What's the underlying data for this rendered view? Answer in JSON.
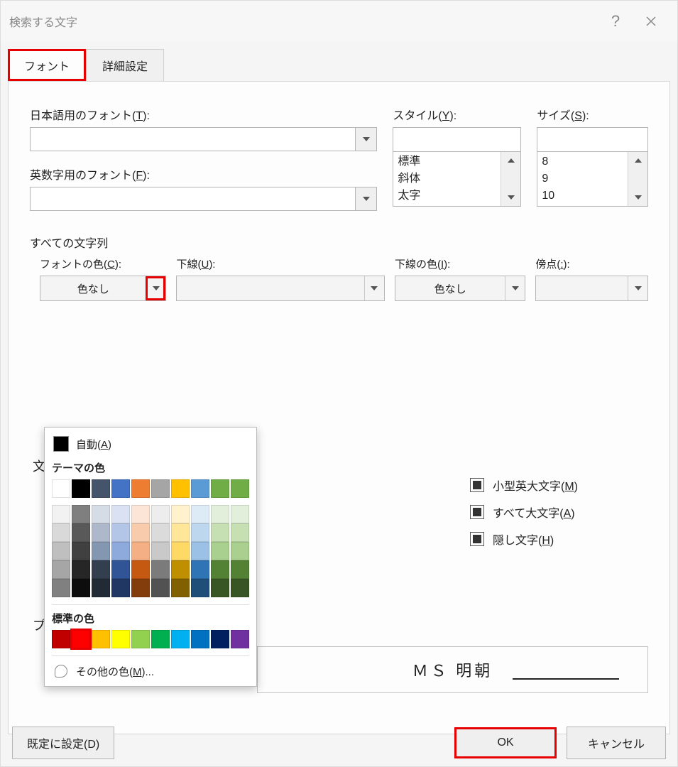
{
  "title": "検索する文字",
  "tabs": {
    "font": "フォント",
    "adv": "詳細設定"
  },
  "labels": {
    "jpfont": "日本語用のフォント(",
    "jpfont_key": "T",
    "enfont": "英数字用のフォント(",
    "enfont_key": "F",
    "style": "スタイル(",
    "style_key": "Y",
    "size": "サイズ(",
    "size_key": "S",
    "allchars": "すべての文字列",
    "fontcolor": "フォントの色(",
    "fontcolor_key": "C",
    "underline": "下線(",
    "underline_key": "U",
    "ulcolor": "下線の色(",
    "ulcolor_key": "I",
    "emph": "傍点(",
    "emph_key": ":",
    "close_paren": "):"
  },
  "style_items": [
    "標準",
    "斜体",
    "太字"
  ],
  "size_items": [
    "8",
    "9",
    "10"
  ],
  "dd": {
    "nocolor": "色なし"
  },
  "section_part1": "文",
  "section_part2": "プ",
  "checks": {
    "smallcaps": "小型英大文字(",
    "smallcaps_key": "M",
    "allcaps": "すべて大文字(",
    "allcaps_key": "A",
    "hidden": "隠し文字(",
    "hidden_key": "H",
    "close": ")"
  },
  "preview_font": "ＭＳ 明朝",
  "popup": {
    "auto": "自動(",
    "auto_key": "A",
    "theme": "テーマの色",
    "standard": "標準の色",
    "more": "その他の色(",
    "more_key": "M",
    "more_suffix": ")...",
    "theme_row": [
      "#ffffff",
      "#000000",
      "#44546a",
      "#4472c4",
      "#ed7d31",
      "#a5a5a5",
      "#ffc000",
      "#5b9bd5",
      "#70ad47",
      "#70ad47"
    ],
    "theme_tints": [
      [
        "#f2f2f2",
        "#7f7f7f",
        "#d6dce5",
        "#d9e1f2",
        "#fce4d6",
        "#ededed",
        "#fff2cc",
        "#ddebf7",
        "#e2efda",
        "#e2efda"
      ],
      [
        "#d9d9d9",
        "#595959",
        "#adb9ca",
        "#b4c6e7",
        "#f8cbad",
        "#dbdbdb",
        "#ffe699",
        "#bdd7ee",
        "#c6e0b4",
        "#c6e0b4"
      ],
      [
        "#bfbfbf",
        "#404040",
        "#8497b0",
        "#8ea9db",
        "#f4b084",
        "#c9c9c9",
        "#ffd966",
        "#9bc2e6",
        "#a9d08e",
        "#a9d08e"
      ],
      [
        "#a6a6a6",
        "#262626",
        "#333f4f",
        "#305496",
        "#c65911",
        "#7b7b7b",
        "#bf8f00",
        "#2f75b5",
        "#548235",
        "#548235"
      ],
      [
        "#808080",
        "#0d0d0d",
        "#222b35",
        "#203764",
        "#833c0c",
        "#525252",
        "#806000",
        "#1f4e78",
        "#375623",
        "#375623"
      ]
    ],
    "standard_row": [
      "#c00000",
      "#ff0000",
      "#ffc000",
      "#ffff00",
      "#92d050",
      "#00b050",
      "#00b0f0",
      "#0070c0",
      "#002060",
      "#7030a0"
    ]
  },
  "footer": {
    "default": "既定に設定(D)",
    "ok": "OK",
    "cancel": "キャンセル"
  }
}
